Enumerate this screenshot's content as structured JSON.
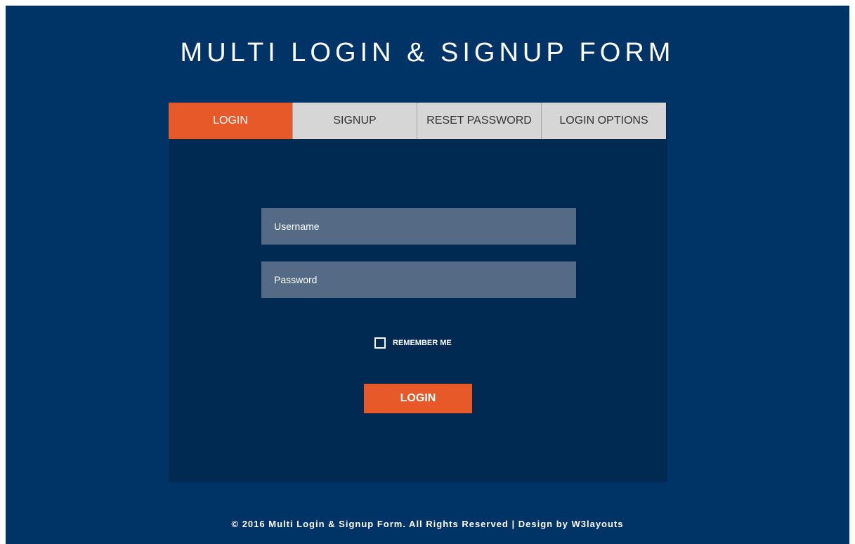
{
  "header": {
    "title": "MULTI LOGIN & SIGNUP FORM"
  },
  "tabs": [
    {
      "label": "LOGIN",
      "active": true
    },
    {
      "label": "SIGNUP",
      "active": false
    },
    {
      "label": "RESET PASSWORD",
      "active": false
    },
    {
      "label": "LOGIN OPTIONS",
      "active": false
    }
  ],
  "form": {
    "username_placeholder": "Username",
    "password_placeholder": "Password",
    "remember_label": "REMEMBER ME",
    "remember_checked": false,
    "submit_label": "LOGIN"
  },
  "footer": {
    "text": "© 2016 Multi Login & Signup Form. All Rights Reserved | Design by W3layouts"
  },
  "colors": {
    "page_background": "#003366",
    "card_background": "#002a52",
    "accent": "#e8592a",
    "tab_inactive": "#d6d6d6",
    "field_background": "#536b84"
  }
}
